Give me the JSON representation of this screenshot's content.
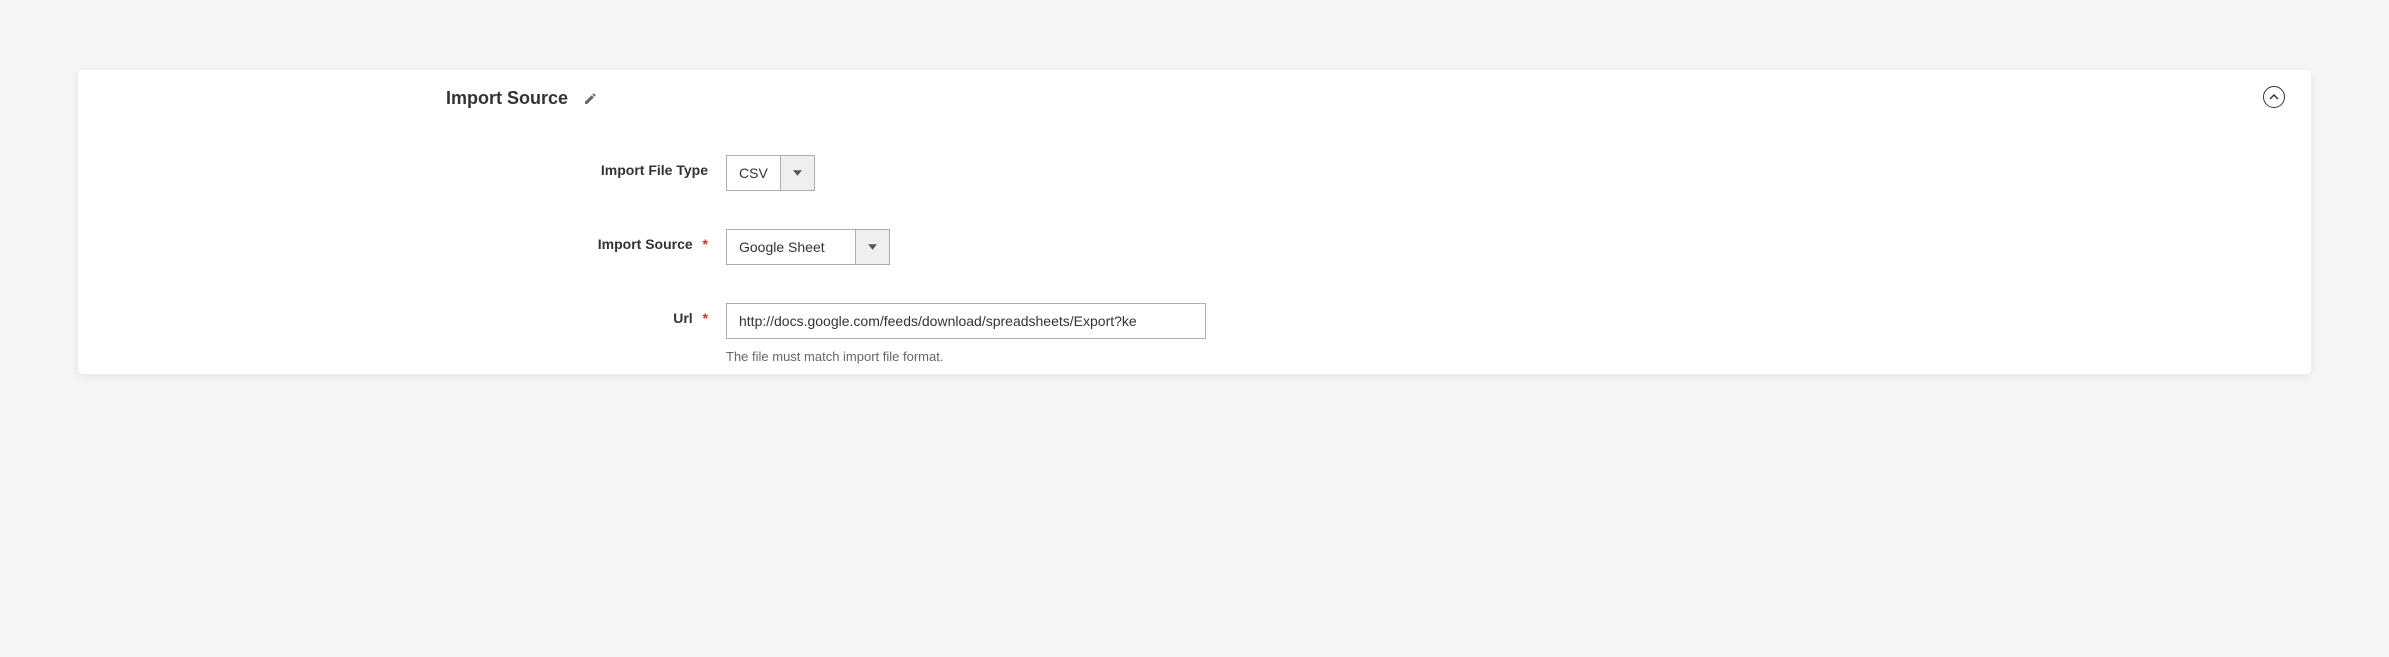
{
  "panel": {
    "title": "Import Source"
  },
  "fields": {
    "file_type": {
      "label": "Import File Type",
      "value": "CSV"
    },
    "source": {
      "label": "Import Source",
      "value": "Google Sheet",
      "required_marker": "*"
    },
    "url": {
      "label": "Url",
      "value": "http://docs.google.com/feeds/download/spreadsheets/Export?ke",
      "hint": "The file must match import file format.",
      "required_marker": "*"
    }
  }
}
